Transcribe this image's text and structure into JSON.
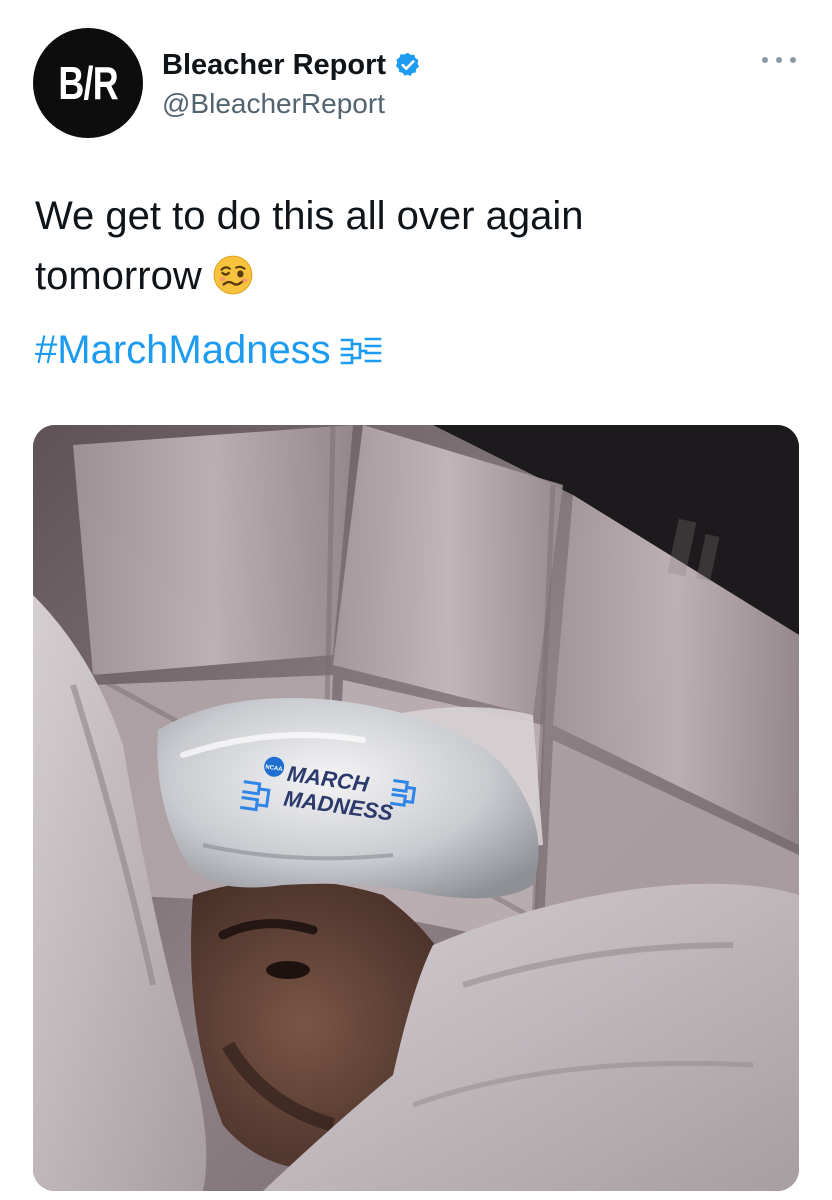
{
  "author": {
    "avatar_text": "B/R",
    "display_name": "Bleacher Report",
    "handle": "@BleacherReport",
    "verified": true,
    "avatar_color": "#0d0d0d",
    "verified_color": "#1d9bf0"
  },
  "tweet": {
    "text_line1": "We get to do this all over again",
    "text_line2": "tomorrow",
    "emoji": "woozy-face-emoji",
    "hashtag": "#MarchMadness",
    "hashtag_icon": "bracket-icon",
    "hashtag_color": "#1d9bf0"
  },
  "media": {
    "logo_line1": "MARCH",
    "logo_line2": "MADNESS",
    "logo_badge": "NCAA"
  },
  "menu_icon": "more-options-icon"
}
